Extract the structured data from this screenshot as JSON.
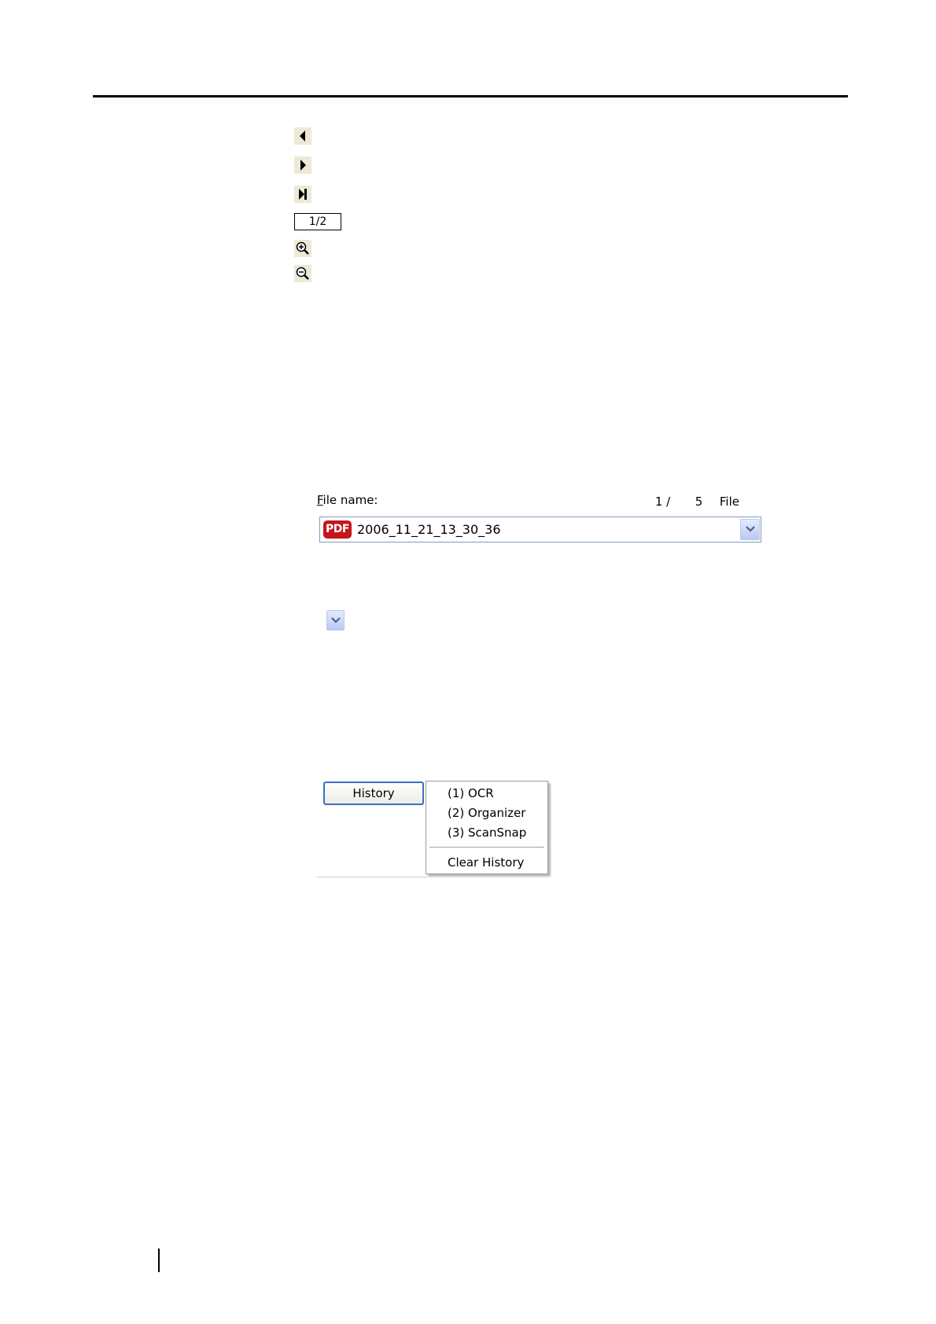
{
  "toolbar": {
    "page_indicator": "1/2",
    "buttons": [
      {
        "icon": "previous-page-icon"
      },
      {
        "icon": "next-page-icon"
      },
      {
        "icon": "last-page-icon"
      },
      {
        "icon": "zoom-in-icon"
      },
      {
        "icon": "zoom-out-icon"
      }
    ]
  },
  "file_panel": {
    "label_accel": "F",
    "label_rest": "ile name:",
    "counter_current": "1 /",
    "counter_total": "5",
    "counter_unit": "File",
    "file_type_badge": "PDF",
    "file_name": "2006_11_21_13_30_36"
  },
  "history": {
    "button_label": "History",
    "menu_items": [
      "(1) OCR",
      "(2) Organizer",
      "(3) ScanSnap"
    ],
    "clear_label": "Clear History"
  },
  "colors": {
    "pdf_badge": "#c4161c",
    "button_focus_border": "#3c6fc4",
    "combo_border": "#7f9db9",
    "toolbar_button_bg": "#ece9d8"
  }
}
